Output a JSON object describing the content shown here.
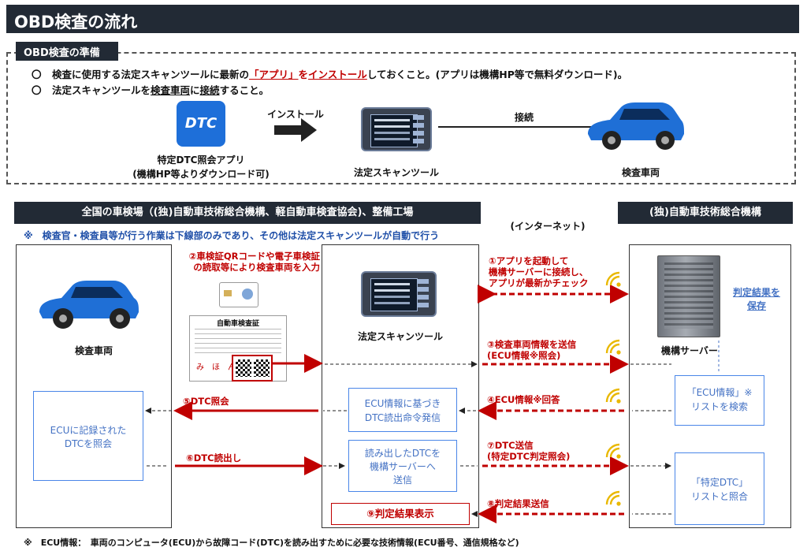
{
  "title": "OBD検査の流れ",
  "prep": {
    "label": "OBD検査の準備",
    "bullet1": {
      "mark": "〇",
      "pre": "検査に使用する法定スキャンツールに最新の",
      "app": "「アプリ」",
      "mid": "を",
      "install": "インストール",
      "post": "しておくこと。(アプリは機構HP等で無料ダウンロード)。"
    },
    "bullet2": {
      "mark": "〇",
      "pre": "法定スキャンツールを",
      "vehicle": "検査車両",
      "mid": "に",
      "connect": "接続",
      "post": "すること。"
    },
    "dtc_icon_text": "DTC",
    "app_caption_line1": "特定DTC照会アプリ",
    "app_caption_line2": "(機構HP等よりダウンロード可)",
    "install_label": "インストール",
    "scan_tool_caption": "法定スキャンツール",
    "connect_label": "接続",
    "vehicle_caption": "検査車両"
  },
  "left_header": "全国の車検場（(独)自動車技術総合機構、軽自動車検査協会)、整備工場",
  "right_header": "(独)自動車技術総合機構",
  "internet_label": "(インターネット)",
  "note": "※　検査官・検査員等が行う作業は下線部のみであり、その他は法定スキャンツールが自動で行う",
  "vehicle_label": "検査車両",
  "ecu_check_box": "ECUに記録された\nDTCを照会",
  "scan_tool_label": "法定スキャンツール",
  "step2": "②車検証QRコードや電子車検証\nの読取等により検査車両を入力",
  "cert_title": "自動車検査証",
  "cert_sample": "み　ほ　ん",
  "step5": "⑤DTC照会",
  "step6": "⑥DTC読出し",
  "box_ecu_info_based": "ECU情報に基づき\nDTC読出命令発信",
  "box_send_read": "読み出したDTCを\n機構サーバーへ\n送信",
  "box_result_display": "⑨判定結果表示",
  "step1": "①アプリを起動して\n機構サーバーに接続し、\nアプリが最新かチェック",
  "step3": "③検査車両情報を送信\n(ECU情報※照会)",
  "step4": "④ECU情報※回答",
  "step7": "⑦DTC送信\n(特定DTC判定照会)",
  "step8": "⑧判定結果送信",
  "server_label": "機構サーバー",
  "save_result": "判定結果を\n保存",
  "box_search": "「ECU情報」※\nリストを検索",
  "box_compare": "「特定DTC」\nリストと照合",
  "footnote": "※　ECU情報：　車両のコンピュータ(ECU)から故障コード(DTC)を読み出すために必要な技術情報(ECU番号、通信規格など)",
  "colors": {
    "header_bg": "#222a35",
    "red": "#c00000",
    "blue": "#4472c4",
    "car_blue": "#1f6fd6"
  }
}
